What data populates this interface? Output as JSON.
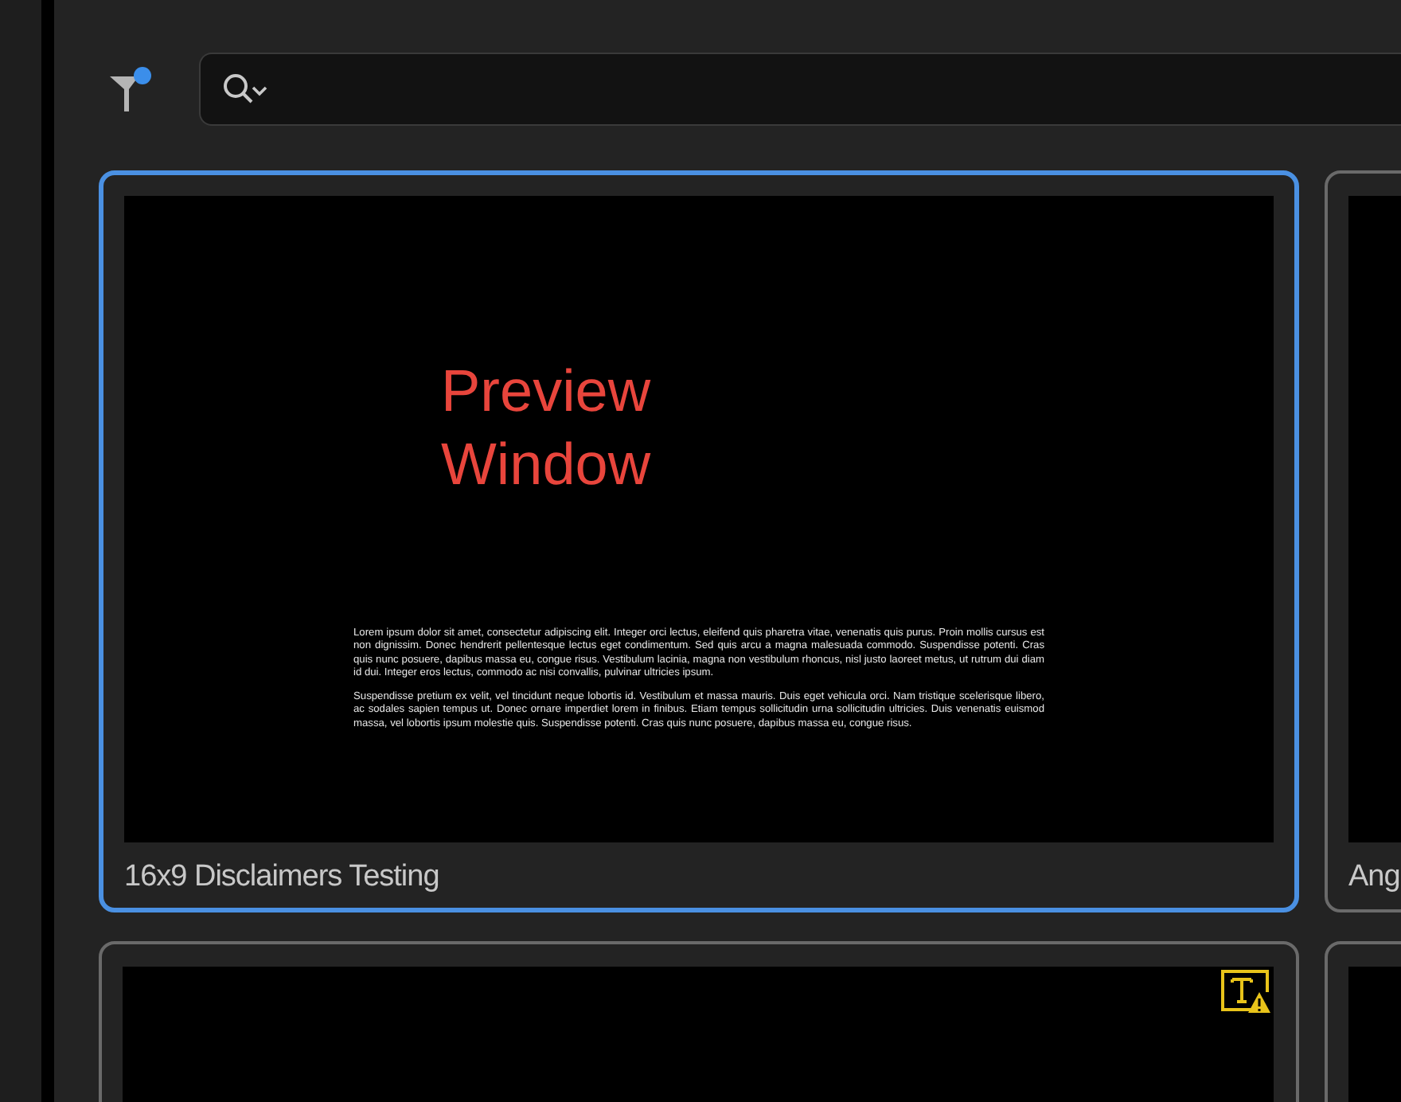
{
  "filter": {
    "active": true
  },
  "cards": [
    {
      "title": "16x9 Disclaimers Testing",
      "selected": true,
      "warning": false,
      "preview": {
        "heading": "Preview\nWindow",
        "paragraphs": [
          "Lorem ipsum dolor sit amet, consectetur adipiscing elit. Integer orci lectus, eleifend quis pharetra vitae, venenatis quis purus. Proin mollis cursus est non dignissim. Donec hendrerit pellentesque lectus eget condimentum. Sed quis arcu a magna malesuada commodo. Suspendisse potenti. Cras quis nunc posuere, dapibus massa eu, congue risus. Vestibulum lacinia, magna non vestibulum rhoncus, nisl justo laoreet metus, ut rutrum dui diam id dui. Integer eros lectus, commodo ac nisi convallis, pulvinar ultricies ipsum.",
          "Suspendisse pretium ex velit, vel tincidunt neque lobortis id. Vestibulum et massa mauris. Duis eget vehicula orci. Nam tristique scelerisque libero, ac sodales sapien tempus ut. Donec ornare imperdiet lorem in finibus. Etiam tempus sollicitudin urna sollicitudin ultricies. Duis venenatis euismod massa, vel lobortis ipsum molestie quis. Suspendisse potenti. Cras quis nunc posuere, dapibus massa eu, congue risus."
        ]
      }
    },
    {
      "title": "Ang",
      "selected": false,
      "warning": false
    },
    {
      "selected": false,
      "warning": true
    },
    {
      "selected": false,
      "warning": false
    }
  ]
}
